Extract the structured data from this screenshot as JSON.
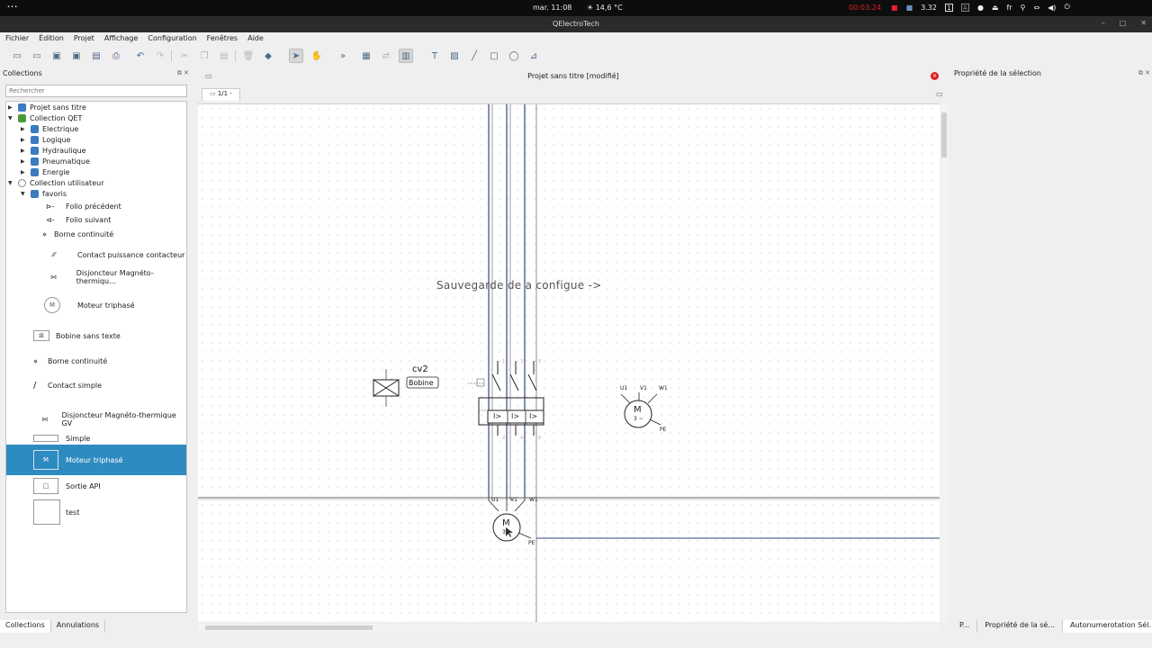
{
  "topbar": {
    "activities": "···",
    "clock": "mar. 11:08",
    "weather": "☀ 14,6 °C",
    "recording": "00:03:24",
    "cpu": "3.32",
    "lang": "fr"
  },
  "window": {
    "title": "QElectroTech"
  },
  "menu": [
    "Fichier",
    "Édition",
    "Projet",
    "Affichage",
    "Configuration",
    "Fenêtres",
    "Aide"
  ],
  "left_panel": {
    "title": "Collections",
    "search_placeholder": "Rechercher",
    "tree": [
      {
        "label": "Projet sans titre",
        "arrow": "▶",
        "indent": 0,
        "color": "#3b7bbf"
      },
      {
        "label": "Collection QET",
        "arrow": "▼",
        "indent": 0,
        "color": "#4a9a3c"
      },
      {
        "label": "Electrique",
        "arrow": "▶",
        "indent": 1,
        "color": "#3b7bbf"
      },
      {
        "label": "Logique",
        "arrow": "▶",
        "indent": 1,
        "color": "#3b7bbf"
      },
      {
        "label": "Hydraulique",
        "arrow": "▶",
        "indent": 1,
        "color": "#3b7bbf"
      },
      {
        "label": "Pneumatique",
        "arrow": "▶",
        "indent": 1,
        "color": "#3b7bbf"
      },
      {
        "label": "Energie",
        "arrow": "▶",
        "indent": 1,
        "color": "#3b7bbf"
      },
      {
        "label": "Collection utilisateur",
        "arrow": "▼",
        "indent": 0,
        "color": "#888888"
      },
      {
        "label": "favoris",
        "arrow": "▼",
        "indent": 1,
        "color": "#3b7bbf"
      }
    ],
    "items": [
      {
        "label": "Folio précédent",
        "icon": "⊳-"
      },
      {
        "label": "Folio suivant",
        "icon": "⊲-"
      },
      {
        "label": "Borne continuité",
        "icon": "⋄"
      },
      {
        "label": "Contact puissance contacteur",
        "icon": "⁄⁄⁄"
      },
      {
        "label": "Disjoncteur Magnéto-thermiqu...",
        "icon": "⋈"
      },
      {
        "label": "Moteur triphasé",
        "icon": "M"
      },
      {
        "label": "Bobine sans texte",
        "icon": "⊠"
      },
      {
        "label": "Borne continuité",
        "icon": "⋄"
      },
      {
        "label": "Contact simple",
        "icon": "/"
      },
      {
        "label": "Disjoncteur Magnéto-thermique GV",
        "icon": "⋈"
      },
      {
        "label": "Simple",
        "icon": ""
      },
      {
        "label": "Moteur triphasé",
        "icon": "M",
        "selected": true
      },
      {
        "label": "Sortie API",
        "icon": "□"
      },
      {
        "label": "test",
        "icon": ""
      }
    ],
    "tabs": [
      "Collections",
      "Annulations"
    ]
  },
  "center": {
    "document_title": "Projet sans titre [modifié]",
    "folio_tab": "1/1 -",
    "diagram": {
      "note": "Sauvegarde de  a configue ->",
      "coil_label": "cv2",
      "coil_tag": "Bobine",
      "breaker_terms": [
        "I>",
        "I>",
        "I>"
      ],
      "motor_terms": [
        "U1",
        "V1",
        "W1"
      ],
      "motor_symbol": "M",
      "motor_phase": "3 ~",
      "earth": "PE"
    }
  },
  "right_panel": {
    "title": "Propriété de la sélection",
    "tabs": [
      "P...",
      "Propriété de la sé...",
      "Autonumerotation Sél..."
    ]
  }
}
